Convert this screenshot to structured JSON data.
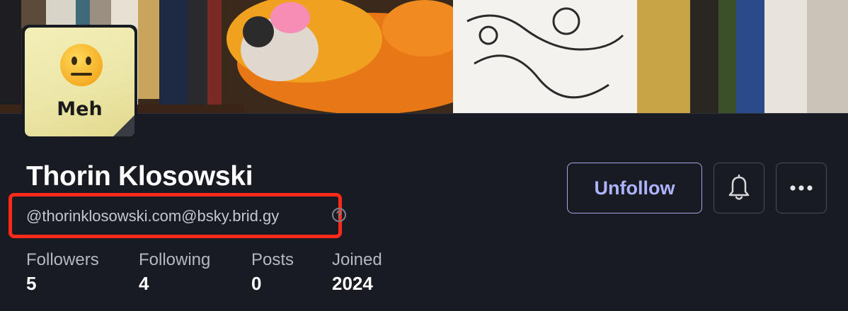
{
  "profile": {
    "display_name": "Thorin Klosowski",
    "handle": "@thorinklosowski.com@bsky.brid.gy",
    "avatar": {
      "label": "Meh",
      "emoji": "neutral-face"
    }
  },
  "actions": {
    "unfollow_label": "Unfollow",
    "notify_icon": "bell-icon",
    "more_icon": "more-horizontal-icon"
  },
  "stats": [
    {
      "label": "Followers",
      "value": "5"
    },
    {
      "label": "Following",
      "value": "4"
    },
    {
      "label": "Posts",
      "value": "0"
    },
    {
      "label": "Joined",
      "value": "2024"
    }
  ],
  "colors": {
    "background": "#191b22",
    "accent": "#aeb3ff",
    "highlight": "#ff2a1a"
  }
}
